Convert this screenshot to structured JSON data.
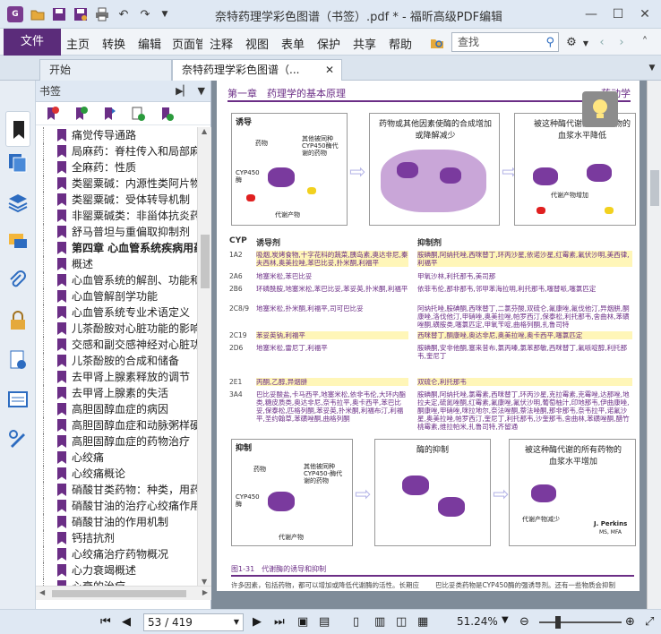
{
  "window": {
    "title": "奈特药理学彩色图谱（书签）.pdf * - 福昕高级PDF编辑器"
  },
  "menu": {
    "file": "文件",
    "items": [
      "主页",
      "转换",
      "编辑",
      "页面管理",
      "注释",
      "视图",
      "表单",
      "保护",
      "共享",
      "帮助"
    ],
    "search_placeholder": "查找"
  },
  "tabs": [
    {
      "label": "开始"
    },
    {
      "label": "奈特药理学彩色图谱（..."
    }
  ],
  "bookmarks": {
    "title": "书签",
    "items": [
      {
        "label": "痛觉传导通路",
        "bold": false
      },
      {
        "label": "局麻药：脊柱传入和局部麻醉",
        "bold": false
      },
      {
        "label": "全麻药：性质",
        "bold": false
      },
      {
        "label": "类罂粟碱：内源性类阿片物质",
        "bold": false
      },
      {
        "label": "类罂粟碱：受体转导机制",
        "bold": false
      },
      {
        "label": "非罂粟碱类：非甾体抗炎药",
        "bold": false
      },
      {
        "label": "舒马普坦与重偏取抑制剂",
        "bold": false
      },
      {
        "label": "第四章 心血管系统疾病用药",
        "bold": true
      },
      {
        "label": "概述",
        "bold": false
      },
      {
        "label": "心血管系统的解剖、功能和病理",
        "bold": false
      },
      {
        "label": "心血管解剖学功能",
        "bold": false
      },
      {
        "label": "心血管系统专业术语定义",
        "bold": false
      },
      {
        "label": "儿茶酚胺对心脏功能的影响",
        "bold": false
      },
      {
        "label": "交感和副交感神经对心脏功能",
        "bold": false
      },
      {
        "label": "儿茶酚胺的合成和储备",
        "bold": false
      },
      {
        "label": "去甲肾上腺素释放的调节",
        "bold": false
      },
      {
        "label": "去甲肾上腺素的失活",
        "bold": false
      },
      {
        "label": "高胆固醇血症的病因",
        "bold": false
      },
      {
        "label": "高胆固醇血症和动脉粥样硬化",
        "bold": false
      },
      {
        "label": "高胆固醇血症的药物治疗",
        "bold": false
      },
      {
        "label": "心绞痛",
        "bold": false
      },
      {
        "label": "心绞痛概论",
        "bold": false
      },
      {
        "label": "硝酸甘类药物：种类，用药",
        "bold": false
      },
      {
        "label": "硝酸甘油的治疗心绞痛作用",
        "bold": false
      },
      {
        "label": "硝酸甘油的作用机制",
        "bold": false
      },
      {
        "label": "钙拮抗剂",
        "bold": false
      },
      {
        "label": "心绞痛治疗药物概况",
        "bold": false
      },
      {
        "label": "心力衰竭概述",
        "bold": false
      },
      {
        "label": "心衰的治疗",
        "bold": false
      }
    ]
  },
  "document": {
    "chapter": "第一章　药理学的基本原理",
    "chapter_right": "药动学",
    "fig_top": {
      "panel1_title": "诱导",
      "panel1_drug": "药物",
      "panel1_other": "其他被同种CYP450酶代谢的药物",
      "panel1_enzyme": "CYP450 酶",
      "panel1_product": "代谢产物",
      "panel2_title": "药物或其他因素使酶的合成增加或降解减少",
      "panel3_title": "被这种酶代谢的所有药物的血浆水平降低",
      "panel3_product": "代谢产物增加"
    },
    "table": {
      "col1": "CYP",
      "col2": "诱导剂",
      "col3": "抑制剂",
      "rows": [
        {
          "cyp": "1A2",
          "ind": "吸烟,炭烤食物,十字花科的蔬菜,胰岛素,奥达非尼,秦夫西林,奥美拉唑,苯巴比妥,扑米酮,利福平",
          "inh": "胺碘酮,阿纳托唑,西咪替丁,环丙沙星,依诺沙星,红霉素,氟伏沙明,美西律,利福平",
          "hl": true
        },
        {
          "cyp": "2A6",
          "ind": "地塞米松,苯巴比妥",
          "inh": "甲氧沙林,利托那韦,美司那",
          "hl": false
        },
        {
          "cyp": "2B6",
          "ind": "环磷酰胺,地塞米松,苯巴比妥,苯妥英,扑米酮,利福平",
          "inh": "依菲韦伦,那非那韦,邻甲苯海拉明,利托那韦,噻替哌,噻氯匹定",
          "hl": false
        },
        {
          "cyp": "2C8/9",
          "ind": "地塞米松,扑米酮,利福平,司可巴比妥",
          "inh": "阿纳托唑,胺碘酮,西咪替丁,二氯芬酸,双硫仑,氟康唑,氟伐他汀,异烟肼,酮康唑,洛伐他汀,甲硝唑,奥美拉唑,帕罗西汀,保泰松,利托那韦,舍曲林,苯磺唑酮,磺胺类,噻氯匹定,甲氧苄啶,曲格列酮,扎鲁司特",
          "hl": false
        },
        {
          "cyp": "2C19",
          "ind": "苯妥英钠,利福平",
          "inh": "西咪替丁,酮康唑,奥达非尼,奥美拉唑,奥卡西平,噻氯匹定",
          "hl": true
        },
        {
          "cyp": "2D6",
          "ind": "地塞米松,雷尼丁,利福平",
          "inh": "胺碘酮,安非他酮,塞来昔布,氯丙嗪,氯苯那敏,西咪替丁,氟哌啶醇,利托那韦,奎尼丁",
          "hl": false
        },
        {
          "cyp": "2E1",
          "ind": "丙酮,乙醇,异烟肼",
          "inh": "双硫仑,利托那韦",
          "hl": true
        },
        {
          "cyp": "3A4",
          "ind": "巴比妥酸盐,卡马西平,地塞米松,依非韦伦,大环内酯类,糖皮质类,奥达非尼,奈韦拉平,奥卡西平,苯巴比妥,保泰松,匹格列酮,苯妥英,扑米酮,利福布汀,利福平,圣约翰草,苯磺唑酮,曲格列酮",
          "inh": "胺碘酮,阿纳托唑,氯霉素,西咪替丁,环丙沙星,克拉霉素,克霉唑,达那唑,地拉夫定,硫氮唑酮,红霉素,氟康唑,氟伏沙明,葡萄柚汁,印地那韦,伊曲康唑,酮康唑,甲硝唑,咪拉地尔,奈法唑酮,萘法唑酮,那非那韦,奈韦拉平,诺氟沙星,奥美拉唑,帕罗西汀,奎尼丁,利托那韦,沙奎那韦,舍曲林,苯磺唑酮,醋竹桃霉素,维拉帕米,扎鲁司特,齐留通",
          "hl": false
        }
      ]
    },
    "fig_bottom": {
      "panel1_title": "抑制",
      "panel1_drug": "药物",
      "panel1_other": "其他被同种CYP450-酶代谢的药物",
      "panel1_enzyme": "CYP450 酶",
      "panel1_product": "代谢产物",
      "panel2_title": "酶的抑制",
      "panel3_title": "被这种酶代谢的所有药物的血浆水平增加",
      "panel3_product": "代谢产物减少",
      "signature_name": "J. Perkins",
      "signature_sub": "MS, MFA"
    },
    "caption": "图1-31　代谢酶的诱导和抑制",
    "footer_left": "许多因素，包括药物，都可以增加或降低代谢酶的活性。长期应",
    "footer_right": "巴比妥类药物是CYP450酶的强诱导剂。还有一些物质会抑制"
  },
  "status": {
    "page": "53 / 419",
    "zoom": "51.24%"
  },
  "colors": {
    "accent": "#6b2e86",
    "file_tab": "#5b2c7a"
  }
}
